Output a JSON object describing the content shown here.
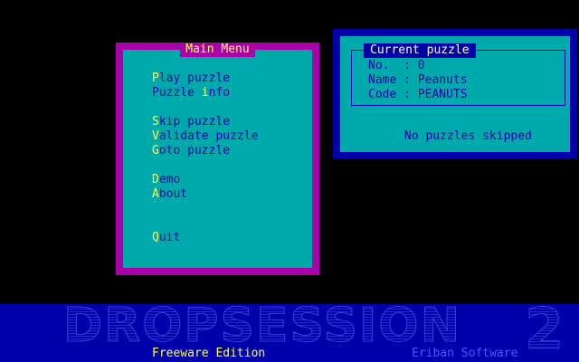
{
  "colors": {
    "background": "#000000",
    "menu_border": "#aa00aa",
    "panel_fill": "#00aaaa",
    "panel_border": "#0000aa",
    "text_blue": "#0000aa",
    "hotkey_yellow": "#ffff55",
    "banner_blue": "#0000aa"
  },
  "main_menu": {
    "title": "Main Menu",
    "items": [
      {
        "hotkey": "P",
        "rest": "lay puzzle"
      },
      {
        "prefix": "Puzzle ",
        "hotkey": "i",
        "rest": "nfo"
      },
      {
        "hotkey": "S",
        "rest": "kip puzzle"
      },
      {
        "hotkey": "V",
        "rest": "alidate puzzle"
      },
      {
        "hotkey": "G",
        "rest": "oto puzzle"
      },
      {
        "hotkey": "D",
        "rest": "emo"
      },
      {
        "hotkey": "A",
        "rest": "bout"
      },
      {
        "hotkey": "Q",
        "rest": "uit"
      }
    ]
  },
  "current_puzzle": {
    "title": "Current puzzle",
    "no_line": "No.  : 0",
    "name_line": "Name : Peanuts",
    "code_line": "Code : PEANUTS",
    "status": "No puzzles skipped"
  },
  "banner": {
    "logo": "DROPSESSION",
    "version_logo": "2",
    "edition": "Freeware Edition",
    "vendor": "Eriban Software"
  }
}
